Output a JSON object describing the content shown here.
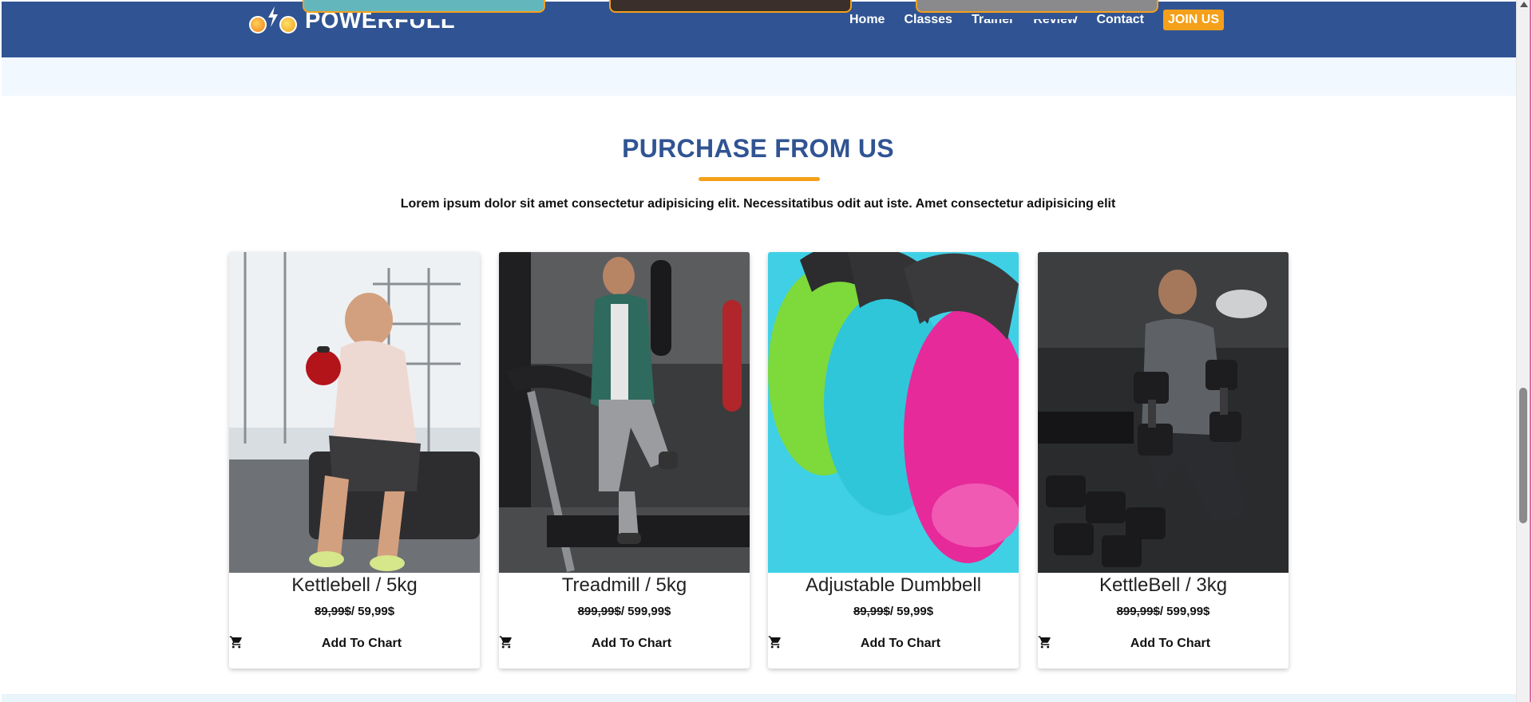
{
  "header": {
    "brand": "POWERFULL",
    "nav": {
      "home": "Home",
      "classes": "Classes",
      "trainer": "Trainer",
      "review": "Review",
      "contact": "Contact",
      "join": "JOIN US"
    }
  },
  "purchase": {
    "title": "PURCHASE FROM US",
    "description": "Lorem ipsum dolor sit amet consectetur adipisicing elit. Necessitatibus odit aut iste. Amet consectetur adipisicing elit",
    "products": [
      {
        "name": "Kettlebell / 5kg",
        "old_price": "89,99$",
        "new_price": "/ 59,99$",
        "button": "Add To Chart"
      },
      {
        "name": "Treadmill / 5kg",
        "old_price": "899,99$",
        "new_price": "/ 599,99$",
        "button": "Add To Chart"
      },
      {
        "name": "Adjustable Dumbbell",
        "old_price": "89,99$",
        "new_price": "/ 59,99$",
        "button": "Add To Chart"
      },
      {
        "name": "KettleBell / 3kg",
        "old_price": "899,99$",
        "new_price": "/ 599,99$",
        "button": "Add To Chart"
      }
    ]
  },
  "colors": {
    "primary": "#305493",
    "accent": "#f5a01a",
    "section_bg": "#f2f8ff"
  },
  "icons": {
    "cart": "shopping-cart-icon",
    "logo": "dumbbell-bolt-logo"
  }
}
